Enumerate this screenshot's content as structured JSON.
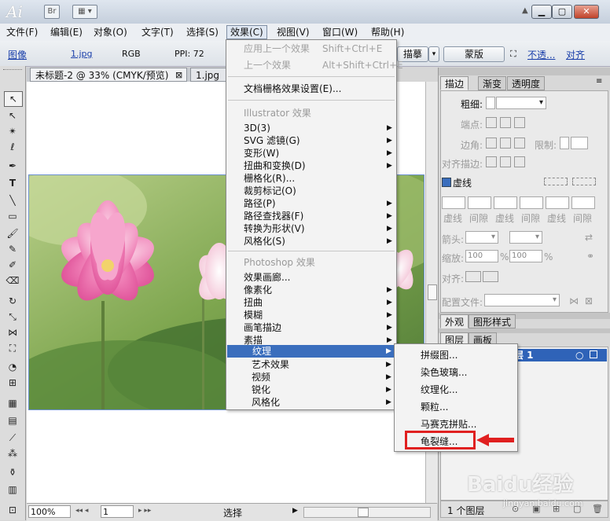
{
  "app": {
    "logo": "Ai",
    "br_label": "Br",
    "window_min": "▁",
    "window_max": "▢",
    "window_close": "✕"
  },
  "menubar": {
    "items": [
      "文件(F)",
      "编辑(E)",
      "对象(O)",
      "文字(T)",
      "选择(S)",
      "效果(C)",
      "视图(V)",
      "窗口(W)",
      "帮助(H)"
    ]
  },
  "controlbar": {
    "image_link": "图像",
    "filename": "1.jpg",
    "colormode": "RGB",
    "ppi": "PPI: 72",
    "trace_button": "描摹",
    "mask_button": "蒙版",
    "opacity_link": "不透...",
    "align_link": "对齐"
  },
  "tabs": {
    "doc1": "未标题-2 @ 33% (CMYK/预览)",
    "doc1_close": "⊠",
    "doc2": "1.jpg @"
  },
  "effect_menu": {
    "apply_last": "应用上一个效果",
    "apply_last_shortcut": "Shift+Ctrl+E",
    "last_effect": "上一个效果",
    "last_effect_shortcut": "Alt+Shift+Ctrl+E",
    "raster_settings": "文档栅格效果设置(E)...",
    "illustrator_header": "Illustrator 效果",
    "illustrator_items": [
      "3D(3)",
      "SVG 滤镜(G)",
      "变形(W)",
      "扭曲和变换(D)",
      "栅格化(R)...",
      "裁剪标记(O)",
      "路径(P)",
      "路径查找器(F)",
      "转换为形状(V)",
      "风格化(S)"
    ],
    "photoshop_header": "Photoshop 效果",
    "photoshop_items": [
      "效果画廊...",
      "像素化",
      "扭曲",
      "模糊",
      "画笔描边",
      "素描",
      "纹理",
      "艺术效果",
      "视频",
      "锐化",
      "风格化"
    ]
  },
  "texture_submenu": {
    "items": [
      "拼缀图...",
      "染色玻璃...",
      "纹理化...",
      "颗粒...",
      "马赛克拼贴...",
      "龟裂缝..."
    ]
  },
  "right_panel": {
    "tabs": [
      "描边",
      "渐变",
      "透明度"
    ],
    "weight_label": "粗细:",
    "cap_label": "端点:",
    "corner_label": "边角:",
    "limit_label": "限制:",
    "align_stroke_label": "对齐描边:",
    "dashed_label": "虚线",
    "dash_labels": [
      "虚线",
      "间隙",
      "虚线",
      "间隙",
      "虚线",
      "间隙"
    ],
    "arrow_label": "箭头:",
    "scale_label": "缩放:",
    "scale_value_1": "100",
    "scale_value_2": "100",
    "percent": "%",
    "align_label": "对齐:",
    "profile_label": "配置文件:",
    "tabs2": [
      "外观",
      "图形样式"
    ],
    "tabs3": [
      "图层",
      "画板"
    ],
    "layer_name": "层 1",
    "layer_count": "1 个图层"
  },
  "statusbar": {
    "zoom": "100%",
    "page": "1",
    "tool": "选择"
  },
  "watermark": {
    "main": "Baidu经验",
    "sub": "jingyan.baidu.com"
  }
}
